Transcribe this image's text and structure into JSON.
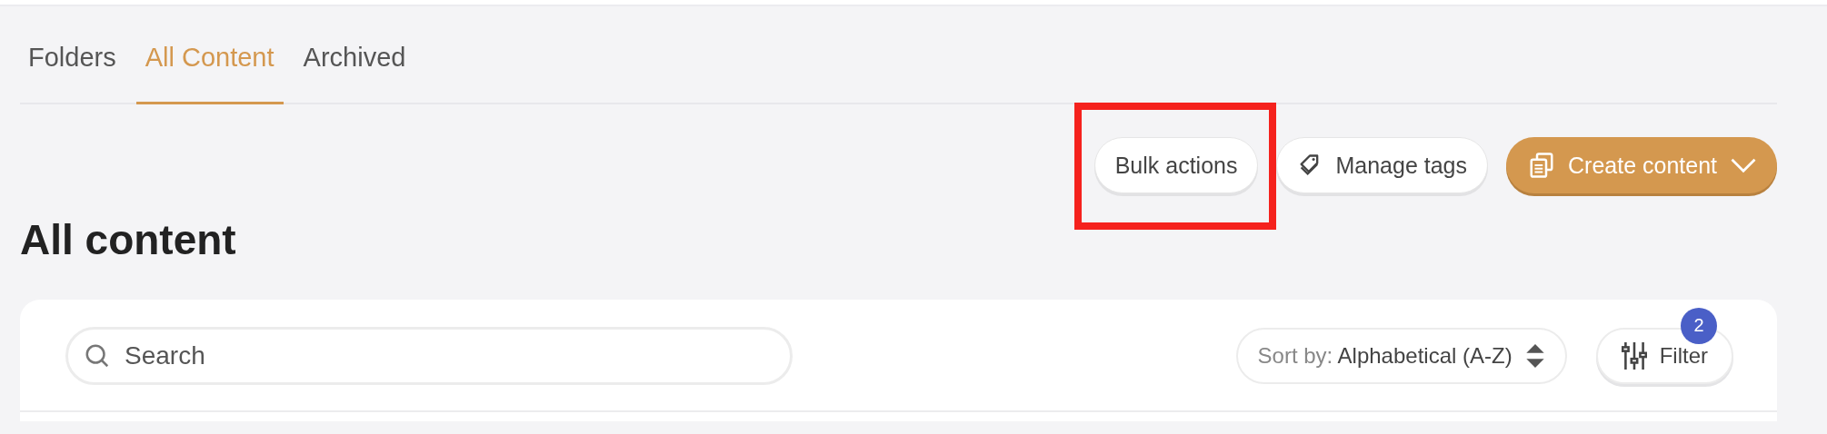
{
  "tabs": [
    {
      "label": "Folders",
      "selected": false
    },
    {
      "label": "All Content",
      "selected": true
    },
    {
      "label": "Archived",
      "selected": false
    }
  ],
  "actions": [
    {
      "kind": "plain",
      "label": "Bulk actions",
      "highlighted": true
    },
    {
      "kind": "tag",
      "label": "Manage tags",
      "highlighted": false
    },
    {
      "kind": "primary",
      "label": "Create content",
      "highlighted": false
    }
  ],
  "heading": "All content",
  "search": {
    "placeholder": "Search"
  },
  "sort": {
    "prefix": "Sort by:",
    "value": "Alphabetical (A-Z)"
  },
  "filter": {
    "label": "Filter",
    "badge": "2"
  }
}
